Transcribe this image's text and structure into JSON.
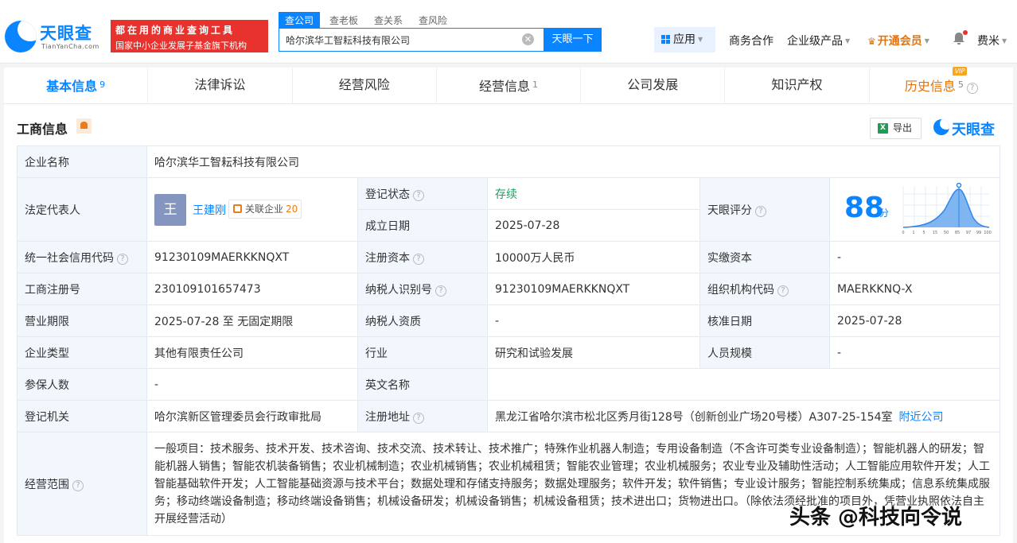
{
  "header": {
    "logo_cn": "天眼查",
    "logo_en": "TianYanCha.com",
    "slogan_line1": "都在用的商业查询工具",
    "slogan_line2": "国家中小企业发展子基金旗下机构",
    "search_tabs": [
      "查公司",
      "查老板",
      "查关系",
      "查风险"
    ],
    "search_value": "哈尔滨华工智耘科技有限公司",
    "search_button": "天眼一下",
    "app_button": "应用",
    "nav": {
      "business": "商务合作",
      "enterprise": "企业级产品",
      "vip": "开通会员",
      "user": "费米"
    }
  },
  "tabs": [
    {
      "label": "基本信息",
      "count": "9"
    },
    {
      "label": "法律诉讼",
      "count": ""
    },
    {
      "label": "经营风险",
      "count": ""
    },
    {
      "label": "经营信息",
      "count": "1"
    },
    {
      "label": "公司发展",
      "count": ""
    },
    {
      "label": "知识产权",
      "count": ""
    },
    {
      "label": "历史信息",
      "count": "5",
      "tag": "VIP"
    }
  ],
  "section": {
    "title": "工商信息",
    "export": "导出",
    "brand": "天眼查"
  },
  "info": {
    "company_name_label": "企业名称",
    "company_name": "哈尔滨华工智耘科技有限公司",
    "legal_rep_label": "法定代表人",
    "legal_rep_avatar": "王",
    "legal_rep_name": "王建刚",
    "related_label": "关联企业",
    "related_count": "20",
    "reg_status_label": "登记状态",
    "reg_status": "存续",
    "found_date_label": "成立日期",
    "found_date": "2025-07-28",
    "score_label": "天眼评分",
    "score": "88",
    "score_unit": "分",
    "score_ticks": [
      "0",
      "1",
      "5",
      "15",
      "50",
      "85",
      "97",
      "99",
      "100"
    ],
    "credit_code_label": "统一社会信用代码",
    "credit_code": "91230109MAERKKNQXT",
    "reg_capital_label": "注册资本",
    "reg_capital": "10000万人民币",
    "paid_capital_label": "实缴资本",
    "paid_capital": "-",
    "reg_no_label": "工商注册号",
    "reg_no": "230109101657473",
    "taxpayer_id_label": "纳税人识别号",
    "taxpayer_id": "91230109MAERKKNQXT",
    "org_code_label": "组织机构代码",
    "org_code": "MAERKKNQ-X",
    "term_label": "营业期限",
    "term": "2025-07-28 至 无固定期限",
    "taxpayer_qual_label": "纳税人资质",
    "taxpayer_qual": "-",
    "approve_date_label": "核准日期",
    "approve_date": "2025-07-28",
    "type_label": "企业类型",
    "type": "其他有限责任公司",
    "industry_label": "行业",
    "industry": "研究和试验发展",
    "staff_label": "人员规模",
    "staff": "-",
    "insured_label": "参保人数",
    "insured": "-",
    "en_name_label": "英文名称",
    "en_name": "",
    "authority_label": "登记机关",
    "authority": "哈尔滨新区管理委员会行政审批局",
    "address_label": "注册地址",
    "address": "黑龙江省哈尔滨市松北区秀月街128号（创新创业广场20号楼）A307-25-154室",
    "nearby": "附近公司",
    "scope_label": "经营范围",
    "scope": "一般项目：技术服务、技术开发、技术咨询、技术交流、技术转让、技术推广；特殊作业机器人制造；专用设备制造（不含许可类专业设备制造）；智能机器人的研发；智能机器人销售；智能农机装备销售；农业机械制造；农业机械销售；农业机械租赁；智能农业管理；农业机械服务；农业专业及辅助性活动；人工智能应用软件开发；人工智能基础软件开发；人工智能基础资源与技术平台；数据处理和存储支持服务；数据处理服务；软件开发；软件销售；专业设计服务；智能控制系统集成；信息系统集成服务；移动终端设备制造；移动终端设备销售；机械设备研发；机械设备销售；机械设备租赁；技术进出口；货物进出口。（除依法须经批准的项目外，凭营业执照依法自主开展经营活动）"
  },
  "watermark": "头条 @科技向令说",
  "colors": {
    "brand": "#0a84ff",
    "accent": "#e2740d",
    "slogan": "#e8322d",
    "status_ok": "#1aa260"
  }
}
